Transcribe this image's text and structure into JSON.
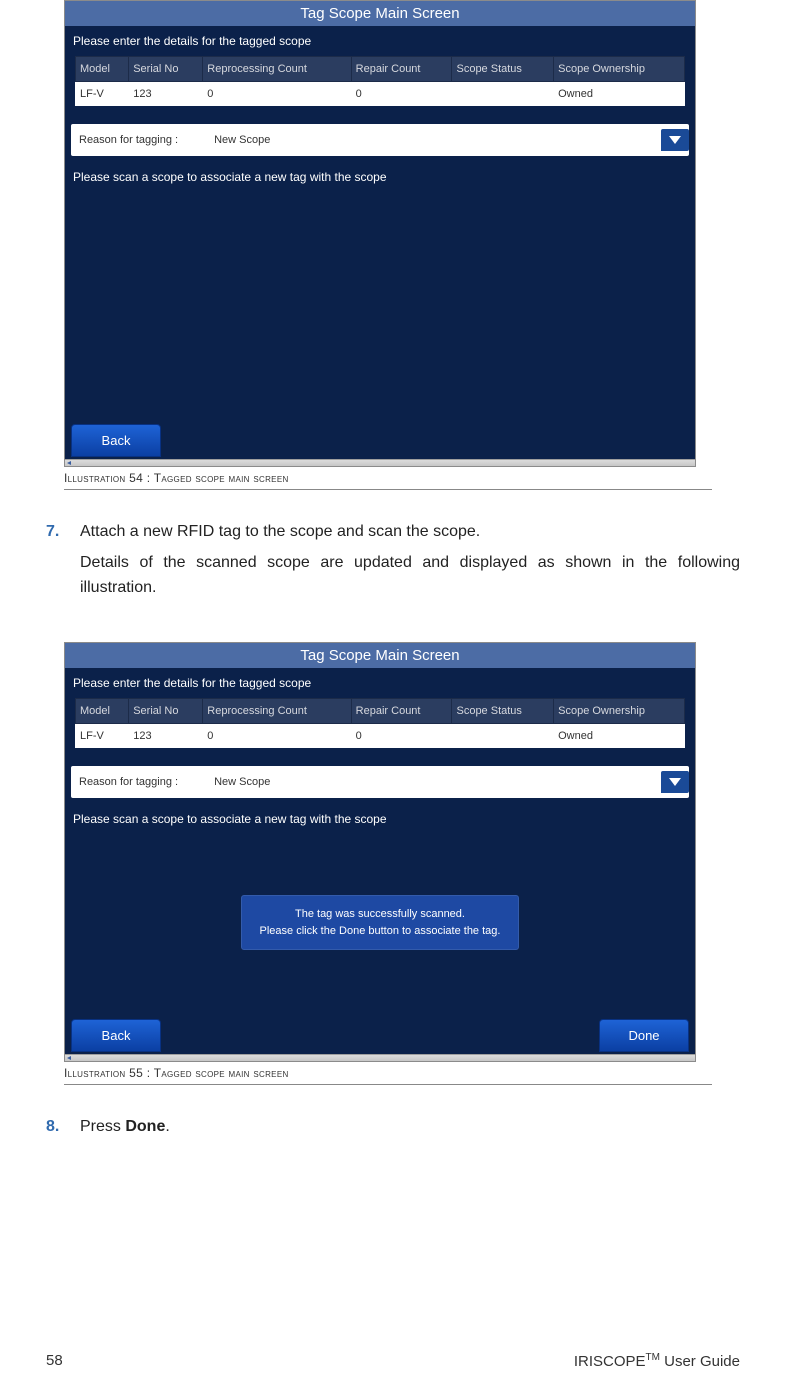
{
  "panels": [
    {
      "title": "Tag Scope Main Screen",
      "subtitle": "Please enter the details for the tagged scope",
      "columns": [
        "Model",
        "Serial No",
        "Reprocessing Count",
        "Repair Count",
        "Scope Status",
        "Scope Ownership"
      ],
      "row": [
        "LF-V",
        "123",
        "0",
        "0",
        "",
        "Owned"
      ],
      "reason_label": "Reason for tagging :",
      "reason_value": "New Scope",
      "scan_msg": "Please scan a scope to associate a new tag with the scope",
      "toast_line1": "",
      "toast_line2": "",
      "back_label": "Back",
      "done_label": "",
      "caption_pre": "Illustration",
      "caption_num": "54",
      "caption_rest": ": Tagged scope main screen"
    },
    {
      "title": "Tag Scope Main Screen",
      "subtitle": "Please enter the details for the tagged scope",
      "columns": [
        "Model",
        "Serial No",
        "Reprocessing Count",
        "Repair Count",
        "Scope Status",
        "Scope Ownership"
      ],
      "row": [
        "LF-V",
        "123",
        "0",
        "0",
        "",
        "Owned"
      ],
      "reason_label": "Reason for tagging :",
      "reason_value": "New Scope",
      "scan_msg": "Please scan a scope to associate a new tag with the scope",
      "toast_line1": "The tag was successfully scanned.",
      "toast_line2": "Please click the Done button to associate the tag.",
      "back_label": "Back",
      "done_label": "Done",
      "caption_pre": "Illustration",
      "caption_num": "55",
      "caption_rest": ": Tagged scope main screen"
    }
  ],
  "steps": {
    "s7_num": "7.",
    "s7_p1": "Attach a new RFID tag to the scope and scan the scope.",
    "s7_p2": "Details of the scanned scope are updated and displayed as shown in the following illustration.",
    "s8_num": "8.",
    "s8_pre": "Press ",
    "s8_bold": "Done",
    "s8_post": "."
  },
  "footer": {
    "page_no": "58",
    "product_pre": "IRISCOPE",
    "product_tm": "TM",
    "product_post": " User Guide"
  }
}
